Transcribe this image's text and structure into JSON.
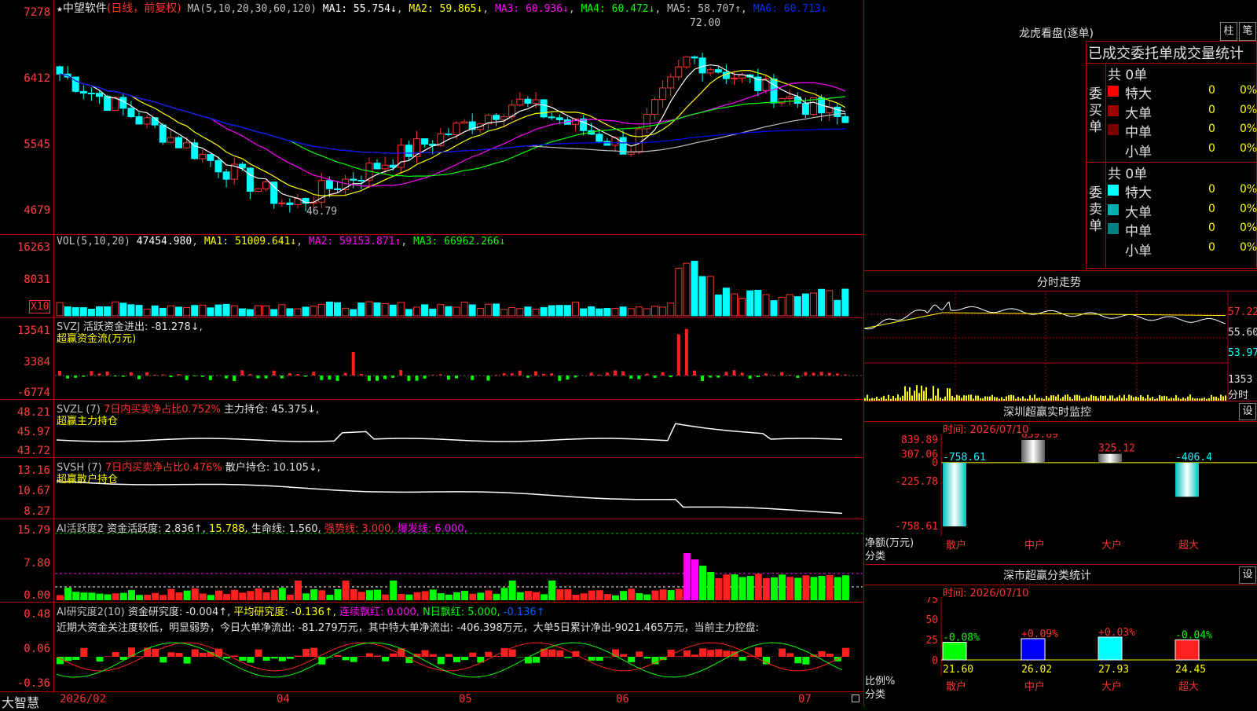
{
  "main_panel": {
    "title_star": "★",
    "stock_name": "中望软件",
    "period": "(日线，前复权)",
    "ma_label": "MA(5,10,20,30,60,120)",
    "ma1": "MA1: 55.754↓",
    "ma2": "MA2: 59.865↓",
    "ma3": "MA3: 60.936↓",
    "ma4": "MA4: 60.472↓",
    "ma5": "MA5: 58.707↑",
    "ma6": "MA6: 60.713↓",
    "y_ticks": [
      "7278",
      "6412",
      "5545",
      "4679"
    ],
    "high_label": "72.00",
    "low_label": "46.79",
    "colors": {
      "ma1": "#ffffff",
      "ma2": "#ffff00",
      "ma3": "#ff00ff",
      "ma4": "#00ff00",
      "ma5": "#c0c0c0",
      "ma6": "#0000ff",
      "up": "#ff3030",
      "down": "#00ffff"
    }
  },
  "vol_panel": {
    "label": "VOL(5,10,20)",
    "value": "47454.980",
    "ma1": "MA1: 51009.641↓",
    "ma2": "MA2: 59153.871↑",
    "ma3": "MA3: 66962.266↓",
    "y_ticks": [
      "16263",
      "8031"
    ],
    "unit": "X10"
  },
  "svzj_panel": {
    "label": "SVZJ",
    "desc": "活跃资金进出: -81.278↓,",
    "sub": "超赢资金流(万元)",
    "y_ticks": [
      "13541",
      "3384",
      "-6774"
    ]
  },
  "svzl_panel": {
    "label": "SVZL (7)",
    "desc1": "7日内买卖净占比0.752%",
    "desc2": "主力持仓: 45.375↓,",
    "sub": "超赢主力持仓",
    "y_ticks": [
      "48.21",
      "45.97",
      "43.72"
    ]
  },
  "svsh_panel": {
    "label": "SVSH (7)",
    "desc1": "7日内买卖净占比0.476%",
    "desc2": "散户持仓: 10.105↓,",
    "sub": "超赢散户持仓",
    "y_ticks": [
      "13.16",
      "10.67",
      "8.27"
    ]
  },
  "ai_active_panel": {
    "label": "AI活跃度2",
    "desc1": "资金活跃度: 2.836↑,",
    "desc2": "15.788,",
    "desc3": "生命线: 1.560,",
    "desc4": "强势线: 3.000,",
    "desc5": "爆发线: 6.000,",
    "y_ticks": [
      "15.79",
      "7.80",
      "0.00"
    ]
  },
  "ai_research_panel": {
    "label": "AI研究度2(10)",
    "desc1": "资金研究度: -0.004↑,",
    "desc2": "平均研究度: -0.136↑,",
    "desc3": "连续飘红: 0.000,",
    "desc4": "N日飘红: 5.000,",
    "desc5": "-0.136↑",
    "comment": "近期大资金关注度较低，明显弱势，今日大单净流出: -81.279万元，其中特大单净流出: -406.398万元，大单5日累计净出-9021.465万元，当前主力控盘:",
    "y_ticks": [
      "0.48",
      "0.06",
      "-0.36"
    ]
  },
  "x_axis": {
    "brand": "大智慧",
    "labels": [
      "2026/02",
      "04",
      "05",
      "06",
      "07"
    ]
  },
  "dragon_tiger": {
    "title": "龙虎看盘(逐单)",
    "btn1": "柱",
    "btn2": "笔",
    "header": "已成交委托单成交量统计",
    "buy_label": "委买单",
    "sell_label": "委卖单",
    "buy_total": "共 0单",
    "sell_total": "共 0单",
    "buy_rows": [
      {
        "name": "特大",
        "count": "0",
        "pct": "0%",
        "color": "#ff0000"
      },
      {
        "name": "大单",
        "count": "0",
        "pct": "0%",
        "color": "#a00000"
      },
      {
        "name": "中单",
        "count": "0",
        "pct": "0%",
        "color": "#7a0000"
      },
      {
        "name": "小单",
        "count": "0",
        "pct": "0%",
        "color": "#000000"
      }
    ],
    "sell_rows": [
      {
        "name": "特大",
        "count": "0",
        "pct": "0%",
        "color": "#00ffff"
      },
      {
        "name": "大单",
        "count": "0",
        "pct": "0%",
        "color": "#00b0b0"
      },
      {
        "name": "中单",
        "count": "0",
        "pct": "0%",
        "color": "#008080"
      },
      {
        "name": "小单",
        "count": "0",
        "pct": "0%",
        "color": "#000000"
      }
    ]
  },
  "intraday": {
    "title": "分时走势",
    "y_ticks": [
      "57.22",
      "55.60",
      "53.97"
    ],
    "vol_tick": "1353",
    "unit": "分时"
  },
  "sz_monitor": {
    "title": "深圳超赢实时监控",
    "btn": "设",
    "time": "时间: 2026/07/10",
    "y_ticks": [
      "839.89",
      "307.06",
      "0",
      "-225.78",
      "-758.61"
    ],
    "axis_caption1": "净额(万元)",
    "axis_caption2": "分类",
    "categories": [
      "散户",
      "中户",
      "大户",
      "超大"
    ],
    "values": [
      -758.61,
      839.89,
      325.12,
      -406.4
    ],
    "value_labels": [
      "-758.61",
      "839.89",
      "325.12",
      "-406.4"
    ]
  },
  "sz_stats": {
    "title": "深市超赢分类统计",
    "btn": "设",
    "time": "时间: 2026/07/10",
    "y_ticks": [
      "75",
      "50",
      "25",
      "0"
    ],
    "axis_caption1": "比例%",
    "axis_caption2": "分类",
    "categories": [
      "散户",
      "中户",
      "大户",
      "超大"
    ],
    "values": [
      21.6,
      26.02,
      27.93,
      24.45
    ],
    "value_labels": [
      "21.60",
      "26.02",
      "27.93",
      "24.45"
    ],
    "change_labels": [
      "-0.08%",
      "+0.09%",
      "+0.03%",
      "-0.04%"
    ]
  },
  "chart_data": {
    "type": "candlestick",
    "title": "中望软件 (日线，前复权)",
    "x_labels": [
      "2026/02",
      "04",
      "05",
      "06",
      "07"
    ],
    "price_range": [
      46.79,
      72.0
    ],
    "ma_latest": {
      "MA1": 55.754,
      "MA2": 59.865,
      "MA3": 60.936,
      "MA4": 60.472,
      "MA5": 58.707,
      "MA6": 60.713
    },
    "volume_latest": 47454.98,
    "sz_monitor_netamount": {
      "categories": [
        "散户",
        "中户",
        "大户",
        "超大"
      ],
      "values": [
        -758.61,
        839.89,
        325.12,
        -406.4
      ]
    },
    "sz_stats_ratio": {
      "categories": [
        "散户",
        "中户",
        "大户",
        "超大"
      ],
      "values": [
        21.6,
        26.02,
        27.93,
        24.45
      ],
      "changes": [
        "-0.08%",
        "+0.09%",
        "+0.03%",
        "-0.04%"
      ]
    }
  }
}
